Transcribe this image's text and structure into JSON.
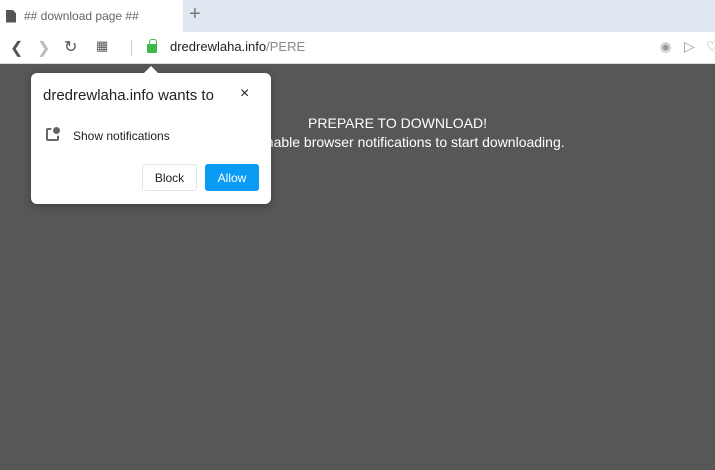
{
  "tab": {
    "title": "## download page ##",
    "new_tab": "+"
  },
  "toolbar": {
    "url_host": "dredrewlaha.info",
    "url_path": "/PERE"
  },
  "page": {
    "headline": "PREPARE TO DOWNLOAD!",
    "subtext": "enable browser notifications to start downloading.",
    "background": "#575757"
  },
  "popup": {
    "title": "dredrewlaha.info wants to",
    "close": "×",
    "permission": "Show notifications",
    "block_label": "Block",
    "allow_label": "Allow",
    "accent": "#0a9cf5"
  }
}
